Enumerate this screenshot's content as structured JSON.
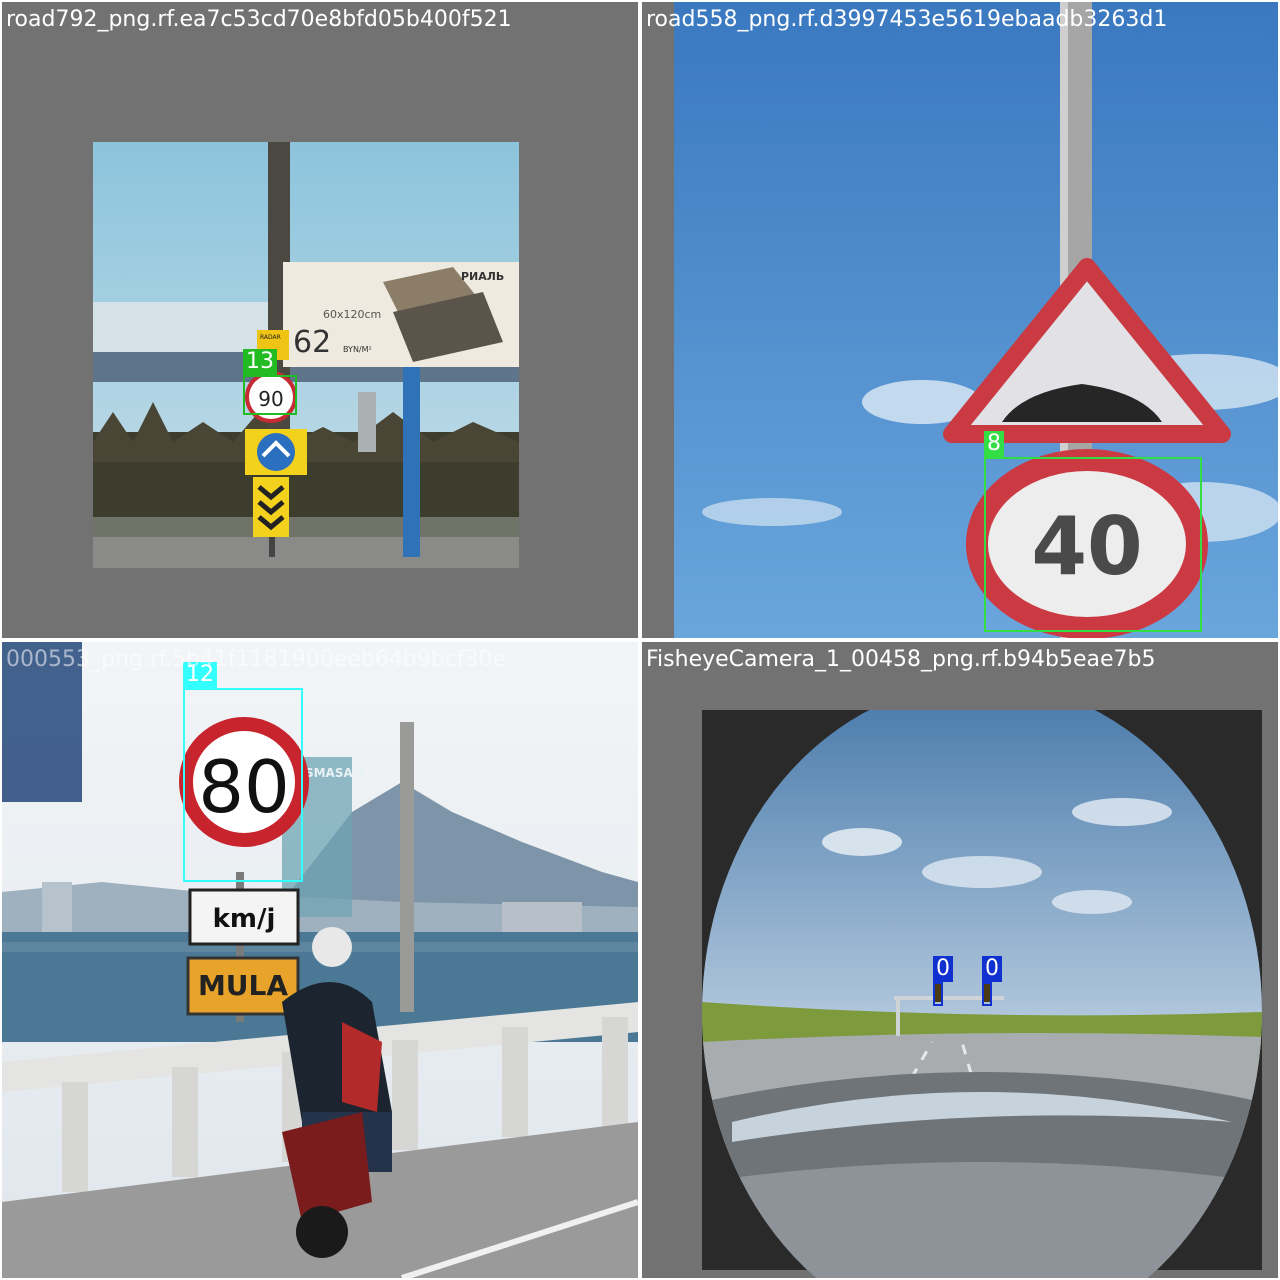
{
  "tiles": [
    {
      "filename": "road792_png.rf.ea7c53cd70e8bfd05b400f521",
      "detections": [
        {
          "class_id": "13",
          "color": "#22bb22"
        }
      ],
      "scene_text": {
        "speed_sign": "90",
        "billboard_number": "62",
        "billboard_size": "60x120cm",
        "billboard_unit": "BYN/M²",
        "billboard_brand": "РИАЛЬ",
        "small_sign": "RADAR"
      }
    },
    {
      "filename": "road558_png.rf.d3997453e5619ebaadb3263d1",
      "detections": [
        {
          "class_id": "8",
          "color": "#33dd44"
        }
      ],
      "scene_text": {
        "speed_sign": "40"
      }
    },
    {
      "filename": "000553_png.rf.5b41f1181900eeb64b9bcf30e",
      "detections": [
        {
          "class_id": "12",
          "color": "#33ffff"
        }
      ],
      "scene_text": {
        "speed_sign": "80",
        "unit_plate": "km/j",
        "place_plate": "MULA",
        "far_sign": "KOSMASAN"
      }
    },
    {
      "filename": "FisheyeCamera_1_00458_png.rf.b94b5eae7b5",
      "detections": [
        {
          "class_id": "0",
          "color": "#1030d0"
        },
        {
          "class_id": "0",
          "color": "#1030d0"
        }
      ]
    }
  ],
  "colors": {
    "padding_gray": "#727272",
    "sky_blue": "#4a86c6",
    "sign_red": "#d0303a"
  }
}
